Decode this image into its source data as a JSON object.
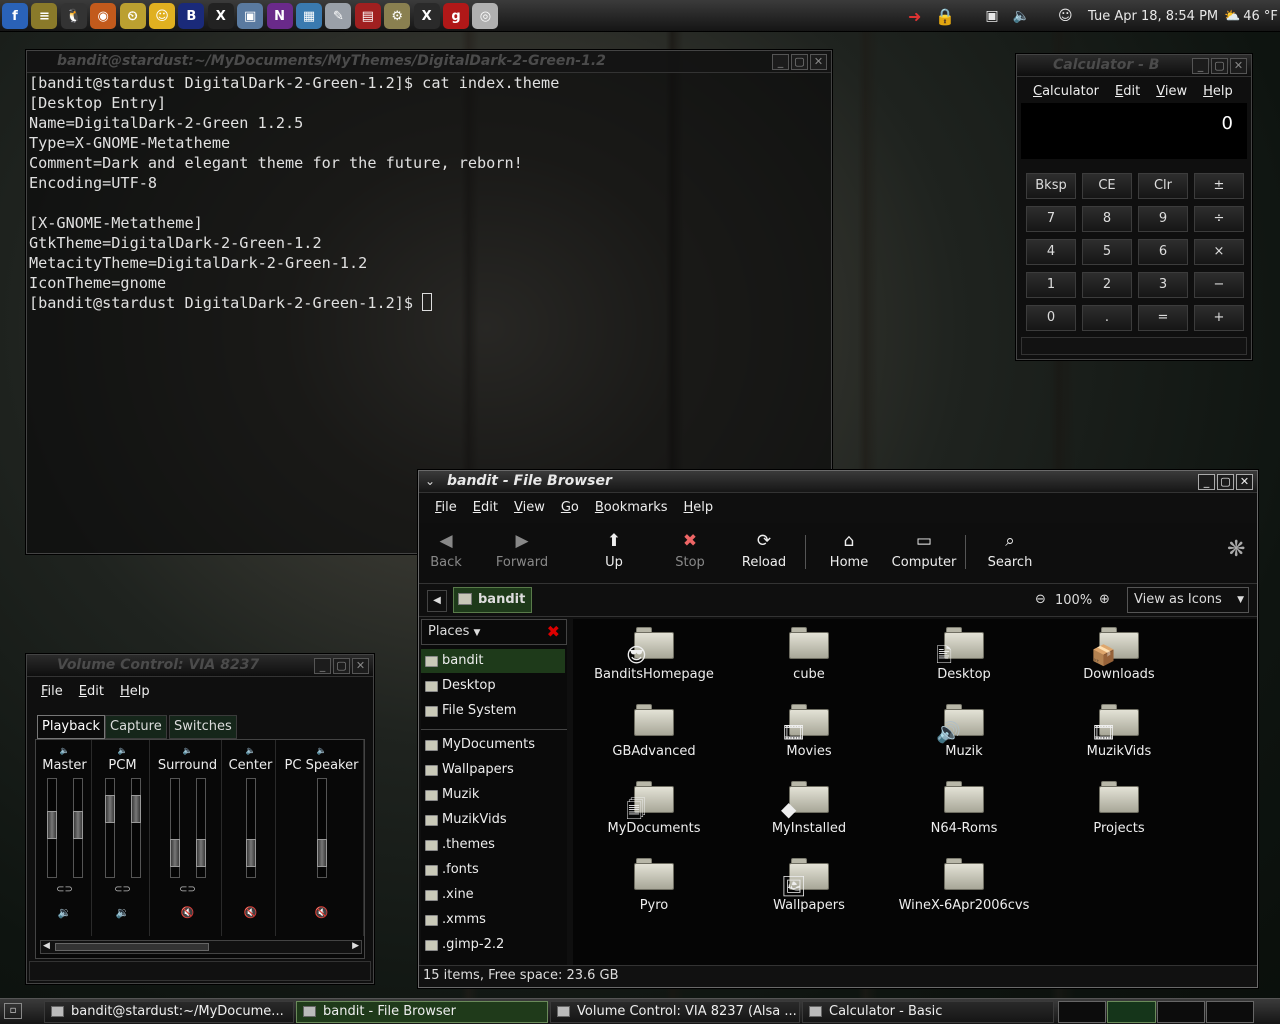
{
  "top_panel": {
    "launchers": [
      {
        "name": "fedora-icon",
        "color": "#2a62b8",
        "glyph": "f"
      },
      {
        "name": "panel-menu-icon",
        "color": "#8a7a2a",
        "glyph": "≡"
      },
      {
        "name": "linux-tux-icon",
        "color": "#333",
        "glyph": "🐧"
      },
      {
        "name": "firefox-icon",
        "color": "#c25a1c",
        "glyph": "◉"
      },
      {
        "name": "clock-app-icon",
        "color": "#bba030",
        "glyph": "⏲"
      },
      {
        "name": "gaim-icon",
        "color": "#e0b020",
        "glyph": "☺"
      },
      {
        "name": "bitch-x-icon",
        "color": "#1a2a7a",
        "glyph": "B"
      },
      {
        "name": "x-terminal-icon",
        "color": "#222",
        "glyph": "X"
      },
      {
        "name": "file-manager-icon",
        "color": "#5a7aa0",
        "glyph": "▣"
      },
      {
        "name": "nvu-icon",
        "color": "#6a2a8a",
        "glyph": "N"
      },
      {
        "name": "image-viewer-icon",
        "color": "#3a7ab0",
        "glyph": "▦"
      },
      {
        "name": "text-editor-icon",
        "color": "#9aa0a8",
        "glyph": "✎"
      },
      {
        "name": "spreadsheet-icon",
        "color": "#a02020",
        "glyph": "▤"
      },
      {
        "name": "disk-utility-icon",
        "color": "#8a8050",
        "glyph": "⚙"
      },
      {
        "name": "xmms-icon",
        "color": "#2a2a2a",
        "glyph": "X"
      },
      {
        "name": "grip-icon",
        "color": "#b01818",
        "glyph": "g"
      },
      {
        "name": "cd-player-icon",
        "color": "#b0b0b0",
        "glyph": "◎"
      }
    ],
    "clock": "Tue Apr 18,  8:54 PM",
    "temperature": "46 °F"
  },
  "terminal": {
    "title": "bandit@stardust:~/MyDocuments/MyThemes/DigitalDark-2-Green-1.2",
    "lines": [
      "[bandit@stardust DigitalDark-2-Green-1.2]$ cat index.theme",
      "[Desktop Entry]",
      "Name=DigitalDark-2-Green 1.2.5",
      "Type=X-GNOME-Metatheme",
      "Comment=Dark and elegant theme for the future, reborn!",
      "Encoding=UTF-8",
      "",
      "[X-GNOME-Metatheme]",
      "GtkTheme=DigitalDark-2-Green-1.2",
      "MetacityTheme=DigitalDark-2-Green-1.2",
      "IconTheme=gnome"
    ],
    "prompt": "[bandit@stardust DigitalDark-2-Green-1.2]$ "
  },
  "calculator": {
    "title": "Calculator - B",
    "menu": [
      "Calculator",
      "Edit",
      "View",
      "Help"
    ],
    "display": "0",
    "buttons": [
      [
        "Bksp",
        "CE",
        "Clr",
        "±"
      ],
      [
        "7",
        "8",
        "9",
        "÷"
      ],
      [
        "4",
        "5",
        "6",
        "×"
      ],
      [
        "1",
        "2",
        "3",
        "−"
      ],
      [
        "0",
        ".",
        "=",
        "+"
      ]
    ]
  },
  "file_browser": {
    "title": "bandit - File Browser",
    "menu": [
      "File",
      "Edit",
      "View",
      "Go",
      "Bookmarks",
      "Help"
    ],
    "toolbar": [
      {
        "label": "Back",
        "icon": "◀"
      },
      {
        "label": "Forward",
        "icon": "▶"
      },
      {
        "label": "Up",
        "icon": "⬆"
      },
      {
        "label": "Stop",
        "icon": "✖"
      },
      {
        "label": "Reload",
        "icon": "⟳"
      },
      {
        "label": "Home",
        "icon": "⌂"
      },
      {
        "label": "Computer",
        "icon": "▭"
      },
      {
        "label": "Search",
        "icon": "⌕"
      }
    ],
    "location": "bandit",
    "zoom": "100%",
    "view_mode": "View as Icons",
    "places_label": "Places",
    "places": [
      "bandit",
      "Desktop",
      "File System"
    ],
    "bookmarks": [
      "MyDocuments",
      "Wallpapers",
      "Muzik",
      "MuzikVids",
      ".themes",
      ".fonts",
      ".xine",
      ".xmms",
      ".gimp-2.2"
    ],
    "items": [
      {
        "name": "BanditsHomepage",
        "emblem": "😎"
      },
      {
        "name": "cube",
        "emblem": ""
      },
      {
        "name": "Desktop",
        "emblem": "🖹"
      },
      {
        "name": "Downloads",
        "emblem": "📦"
      },
      {
        "name": "GBAdvanced",
        "emblem": ""
      },
      {
        "name": "Movies",
        "emblem": "🎞"
      },
      {
        "name": "Muzik",
        "emblem": "🔊"
      },
      {
        "name": "MuzikVids",
        "emblem": "🎞"
      },
      {
        "name": "MyDocuments",
        "emblem": "🗐"
      },
      {
        "name": "MyInstalled",
        "emblem": "◆"
      },
      {
        "name": "N64-Roms",
        "emblem": ""
      },
      {
        "name": "Projects",
        "emblem": ""
      },
      {
        "name": "Pyro",
        "emblem": ""
      },
      {
        "name": "Wallpapers",
        "emblem": "🖼"
      },
      {
        "name": "WineX-6Apr2006cvs",
        "emblem": ""
      }
    ],
    "status": "15 items, Free space: 23.6 GB"
  },
  "volume_control": {
    "title": "Volume Control: VIA 8237",
    "menu": [
      "File",
      "Edit",
      "Help"
    ],
    "tabs": [
      "Playback",
      "Capture",
      "Switches"
    ],
    "channels": [
      {
        "name": "Master",
        "sliders": 2,
        "levels": [
          0.56,
          0.56
        ],
        "muted": false
      },
      {
        "name": "PCM",
        "sliders": 2,
        "levels": [
          0.78,
          0.78
        ],
        "muted": false
      },
      {
        "name": "Surround",
        "sliders": 2,
        "levels": [
          0.17,
          0.17
        ],
        "muted": true
      },
      {
        "name": "Center",
        "sliders": 1,
        "levels": [
          0.17
        ],
        "muted": true
      },
      {
        "name": "PC Speaker",
        "sliders": 1,
        "levels": [
          0.17
        ],
        "muted": true
      }
    ]
  },
  "taskbar": {
    "tasks": [
      "bandit@stardust:~/MyDocume...",
      "bandit - File Browser",
      "Volume Control: VIA 8237 (Alsa ...",
      "Calculator  - Basic"
    ]
  }
}
